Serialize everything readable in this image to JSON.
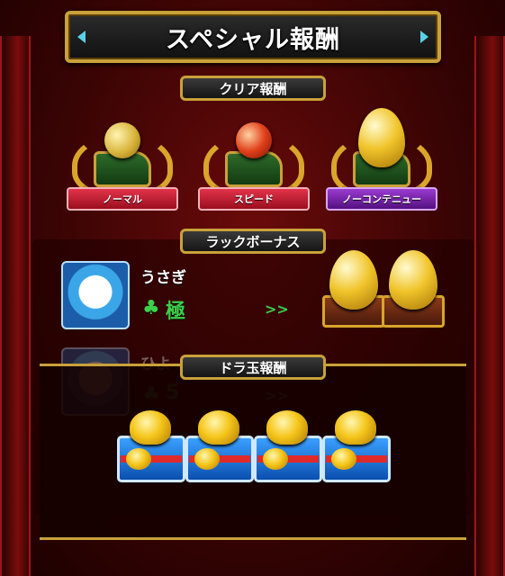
{
  "title": "スペシャル報酬",
  "sections": {
    "clear_label": "クリア報酬",
    "luck_label": "ラックボーナス",
    "dora_label": "ドラ玉報酬"
  },
  "clear_rewards": [
    {
      "label": "ノーマル",
      "item": "gold-coin-icon",
      "ribbon_color": "#c8142c"
    },
    {
      "label": "スピード",
      "item": "red-orb-icon",
      "ribbon_color": "#c8142c"
    },
    {
      "label": "ノーコンテニュー",
      "item": "golden-egg-icon",
      "ribbon_color": "#7a1fb0"
    }
  ],
  "luck_bonus": {
    "characters": [
      {
        "name": "うさぎ",
        "luck": "極"
      },
      {
        "name": "ひよ",
        "luck": "5"
      }
    ],
    "reward_icons": [
      "golden-egg-chest-icon",
      "golden-egg-chest-icon"
    ]
  },
  "dora_rewards": {
    "count": 4,
    "icon": "bell-chest-icon"
  },
  "colors": {
    "frame_gold": "#c9a13a",
    "accent_cyan": "#5ad1e8",
    "luck_green": "#3bd04a",
    "background_red": "#3a0404"
  }
}
